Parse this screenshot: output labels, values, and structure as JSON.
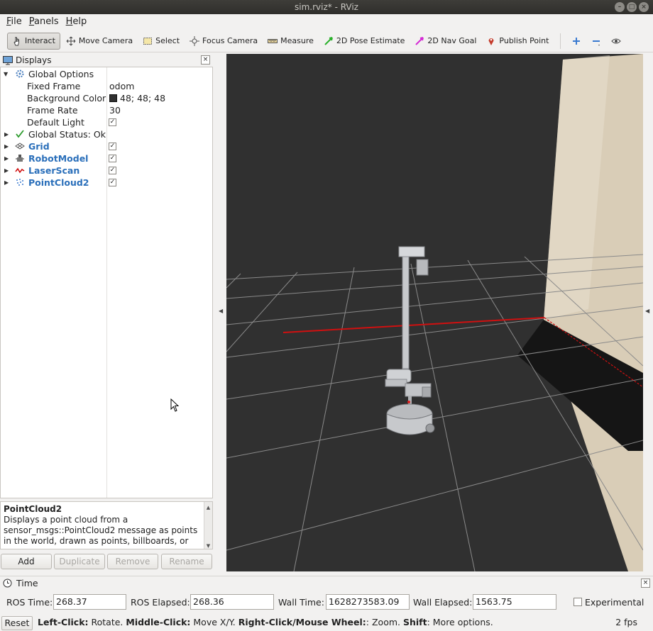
{
  "window": {
    "title": "sim.rviz* - RViz"
  },
  "menu": {
    "file_initial": "F",
    "file_rest": "ile",
    "panels_initial": "P",
    "panels_rest": "anels",
    "help_initial": "H",
    "help_rest": "elp"
  },
  "toolbar": {
    "interact": "Interact",
    "move_camera": "Move Camera",
    "select": "Select",
    "focus_camera": "Focus Camera",
    "measure": "Measure",
    "pose_estimate": "2D Pose Estimate",
    "nav_goal": "2D Nav Goal",
    "publish_point": "Publish Point"
  },
  "displays": {
    "title": "Displays",
    "close": "×",
    "global_options": "Global Options",
    "fixed_frame_label": "Fixed Frame",
    "fixed_frame_value": "odom",
    "bg_color_label": "Background Color",
    "bg_color_value": "48; 48; 48",
    "bg_color_hex": "#303030",
    "frame_rate_label": "Frame Rate",
    "frame_rate_value": "30",
    "default_light_label": "Default Light",
    "global_status": "Global Status: Ok",
    "items": [
      {
        "label": "Grid",
        "checked": true
      },
      {
        "label": "RobotModel",
        "checked": true
      },
      {
        "label": "LaserScan",
        "checked": true
      },
      {
        "label": "PointCloud2",
        "checked": true
      }
    ],
    "check_mark": "✓",
    "description_title": "PointCloud2",
    "description_body": "Displays a point cloud from a sensor_msgs::PointCloud2 message as points in the world, drawn as points, billboards, or",
    "buttons": {
      "add": "Add",
      "duplicate": "Duplicate",
      "remove": "Remove",
      "rename": "Rename"
    }
  },
  "time": {
    "title": "Time",
    "close": "×",
    "ros_time_label": "ROS Time:",
    "ros_time": "268.37",
    "ros_elapsed_label": "ROS Elapsed:",
    "ros_elapsed": "268.36",
    "wall_time_label": "Wall Time:",
    "wall_time": "1628273583.09",
    "wall_elapsed_label": "Wall Elapsed:",
    "wall_elapsed": "1563.75",
    "experimental_label": "Experimental"
  },
  "status": {
    "reset": "Reset",
    "left_click": "Left-Click:",
    "left_click_action": " Rotate. ",
    "middle_click": "Middle-Click:",
    "middle_click_action": " Move X/Y. ",
    "right_click": "Right-Click/Mouse Wheel:",
    "right_click_action": ": Zoom. ",
    "shift": "Shift",
    "shift_action": ": More options.",
    "fps": "2 fps"
  },
  "colors": {
    "grid_line": "#8a8a8a",
    "laser": "#d01010",
    "highlight_blue": "#2a6fba"
  }
}
